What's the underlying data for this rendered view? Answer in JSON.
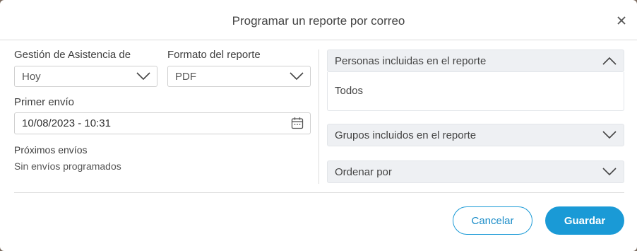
{
  "dialog": {
    "title": "Programar un reporte por correo"
  },
  "left": {
    "attendance_label": "Gestión de Asistencia de",
    "attendance_value": "Hoy",
    "format_label": "Formato del reporte",
    "format_value": "PDF",
    "first_send_label": "Primer envío",
    "first_send_value": "10/08/2023 - 10:31",
    "next_sends_label": "Próximos envíos",
    "next_sends_value": "Sin envíos programados"
  },
  "right": {
    "persons_title": "Personas incluidas en el reporte",
    "persons_value": "Todos",
    "groups_title": "Grupos incluidos en el reporte",
    "order_title": "Ordenar por"
  },
  "footer": {
    "cancel_label": "Cancelar",
    "save_label": "Guardar"
  },
  "colors": {
    "accent": "#1a9ad6",
    "panel_header_bg": "#eef0f3"
  },
  "icons": [
    "close-icon",
    "chevron-down-icon",
    "chevron-up-icon",
    "calendar-icon"
  ]
}
